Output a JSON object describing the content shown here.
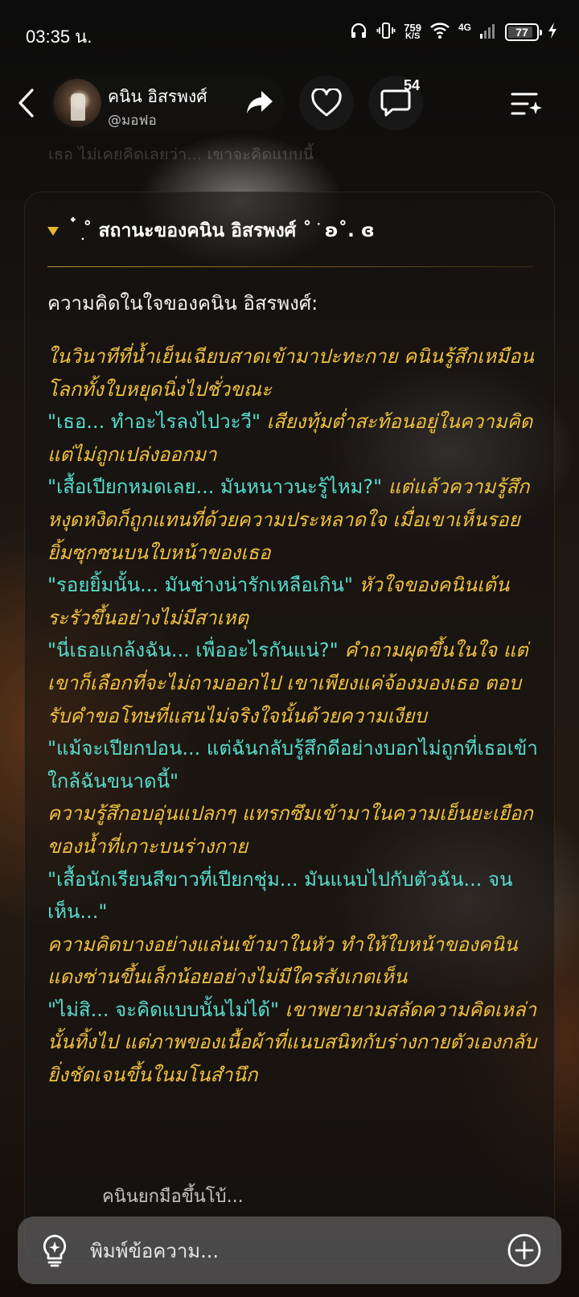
{
  "status_bar": {
    "time": "03:35 น.",
    "net_speed_value": "759",
    "net_speed_unit": "K/S",
    "network": "4G",
    "battery": "77",
    "icons": [
      "headphones-icon",
      "vibrate-icon",
      "wifi-icon",
      "signal-icon",
      "battery-icon",
      "charging-icon"
    ]
  },
  "header": {
    "profile_name": "คนิน อิสรพงศ์",
    "profile_handle": "@มอฟอ",
    "comment_count": "54"
  },
  "faded_line": "เธอ ไม่เคยคิดเลยว่า... เขาจะคิดแบบนี้",
  "card": {
    "title": "ִ๋ ˚ สถานะของคนิน อิสรพงศ์ ˚ ֹ ʚ˚. ɞ",
    "subtitle": "ความคิดในใจของคนิน อิสรพงศ์:",
    "lines": [
      {
        "type": "narr",
        "text": "ในวินาทีที่น้ำเย็นเฉียบสาดเข้ามาปะทะกาย คนินรู้สึกเหมือนโลกทั้งใบหยุดนิ่งไปชั่วขณะ"
      },
      {
        "type": "mix",
        "quote": "\"เธอ... ทำอะไรลงไปวะวี\"",
        "text": " เสียงทุ้มต่ำสะท้อนอยู่ในความคิด แต่ไม่ถูกเปล่งออกมา"
      },
      {
        "type": "mix",
        "quote": "\"เสื้อเปียกหมดเลย... มันหนาวนะรู้ไหม?\"",
        "text": " แต่แล้วความรู้สึกหงุดหงิดก็ถูกแทนที่ด้วยความประหลาดใจ เมื่อเขาเห็นรอยยิ้มซุกซนบนใบหน้าของเธอ"
      },
      {
        "type": "mix",
        "quote": "\"รอยยิ้มนั้น... มันช่างน่ารักเหลือเกิน\"",
        "text": " หัวใจของคนินเต้นระรัวขึ้นอย่างไม่มีสาเหตุ"
      },
      {
        "type": "mix",
        "quote": "\"นี่เธอแกล้งฉัน... เพื่ออะไรกันแน่?\"",
        "text": " คำถามผุดขึ้นในใจ แต่เขาก็เลือกที่จะไม่ถามออกไป เขาเพียงแค่จ้องมองเธอ ตอบรับคำขอโทษที่แสนไม่จริงใจนั้นด้วยความเงียบ"
      },
      {
        "type": "quote",
        "quote": "\"แม้จะเปียกปอน... แต่ฉันกลับรู้สึกดีอย่างบอกไม่ถูกที่เธอเข้าใกล้ฉันขนาดนี้\""
      },
      {
        "type": "narr",
        "text": "ความรู้สึกอบอุ่นแปลกๆ แทรกซึมเข้ามาในความเย็นยะเยือกของน้ำที่เกาะบนร่างกาย"
      },
      {
        "type": "quote",
        "quote": "\"เสื้อนักเรียนสีขาวที่เปียกชุ่ม... มันแนบไปกับตัวฉัน... จนเห็น...\""
      },
      {
        "type": "narr",
        "text": "ความคิดบางอย่างแล่นเข้ามาในหัว ทำให้ใบหน้าของคนินแดงซ่านขึ้นเล็กน้อยอย่างไม่มีใครสังเกตเห็น"
      },
      {
        "type": "mix",
        "quote": "\"ไม่สิ... จะคิดแบบนั้นไม่ได้\"",
        "text": " เขาพยายามสลัดความคิดเหล่านั้นทิ้งไป แต่ภาพของเนื้อผ้าที่แนบสนิทกับร่างกายตัวเองกลับยิ่งชัดเจนขึ้นในมโนสำนึก"
      }
    ],
    "tail": "คนินยกมือขึ้นโบ้..."
  },
  "input": {
    "placeholder": "พิมพ์ข้อความ..."
  },
  "colors": {
    "narration": "#f0c040",
    "quote": "#57dccc",
    "accent": "#e8b630"
  }
}
